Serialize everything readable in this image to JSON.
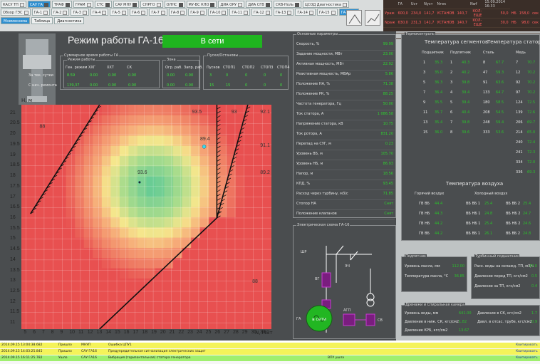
{
  "nav": {
    "row1": [
      "КАСУ ТП",
      "САУ ГА",
      "ТРАФ",
      "ГРАМ",
      "СТС",
      "САУ МНУ",
      "СНРГО",
      "ОЛНС",
      "МУ-ВС КЛО",
      "ДИА ОРУ",
      "ДИА СГВ",
      "СКВ-Ноль",
      "ЦСОД Диагностика"
    ],
    "row1_active": 1,
    "row2": [
      "Обзор ГЭС",
      "ГА-1",
      "ГА-2",
      "ГА-3",
      "ГА-4",
      "ГА-5",
      "ГА-6",
      "ГА-7",
      "ГА-8",
      "ГА-9",
      "ГА-10",
      "ГА-11",
      "ГА-12",
      "ГА-13",
      "ГА-14",
      "ГА-15",
      "ГА-16"
    ],
    "row2_active": 16,
    "tabs": [
      "Мнемосхема",
      "Таблица",
      "Диагностика"
    ]
  },
  "summary": {
    "headers": [
      "",
      "ГА",
      "Uст",
      "Nуст",
      "Nтек",
      "",
      "Nwf"
    ],
    "time": "15.09.2014 16:33",
    "rows": [
      {
        "label": "Ураж",
        "vals": [
          "600,0",
          "234,0",
          "141,7",
          "УСТАНОВ",
          "140,7",
          "КОЛ-ЕЩЕ",
          "50,0",
          "НБ",
          "158,0",
          "сек"
        ],
        "red": true
      },
      {
        "label": "Nраж",
        "vals": [
          "630,0",
          "231,3",
          "141,7",
          "УСТАНОВ",
          "140,7",
          "КОЛ-ЕЩЕ",
          "30,0",
          "НБ",
          "98,0",
          "сек"
        ],
        "red": true
      }
    ]
  },
  "header": {
    "title": "Режим работы ГА-16",
    "status": "В сети"
  },
  "time_block": {
    "legend": "Суммарное время работы ГА",
    "mode_legend": "Режим работы",
    "zone_legend": "Зона",
    "cols": [
      "Ген. режим",
      "ХХГ",
      "ХХТ",
      "СК",
      "Огр. раб.",
      "Запр. раб."
    ],
    "rows": [
      {
        "label": "За тек. сутки",
        "vals": [
          "8.59",
          "0.00",
          "0.00",
          "0.00",
          "0.00",
          "0.00"
        ]
      },
      {
        "label": "С нач. ремонта",
        "vals": [
          "139,37",
          "0.00",
          "0.00",
          "0.00",
          "0.00",
          "0.00"
        ]
      }
    ]
  },
  "starts_block": {
    "legend": "Пуски/Остановы",
    "cols": [
      "Пусков",
      "СТОП1",
      "СТОП2",
      "СТОП3",
      "СТОП4"
    ],
    "rows": [
      [
        "3",
        "0",
        "0",
        "0",
        "0"
      ],
      [
        "15",
        "15",
        "0",
        "0",
        "0"
      ]
    ]
  },
  "chart_data": {
    "type": "heatmap",
    "title": "",
    "ylabel": "H, м",
    "xlabel": "N, МВт",
    "x_ticks": [
      5,
      6,
      7,
      8,
      9,
      10,
      11,
      12,
      13,
      14,
      15,
      16,
      17,
      18,
      19,
      20,
      21,
      22,
      23,
      24,
      25,
      26,
      27,
      28,
      29,
      30,
      31
    ],
    "y_ticks": [
      11,
      11.5,
      12,
      12.5,
      13,
      13.5,
      14,
      14.5,
      15,
      15.5,
      16,
      16.5,
      17,
      17.5,
      18,
      18.5,
      19,
      19.5,
      20,
      20.5,
      21
    ],
    "xlim": [
      4.5,
      32
    ],
    "ylim": [
      10.7,
      21.4
    ],
    "contour_labels": [
      {
        "text": "88",
        "x": 6.8,
        "y": 20.3
      },
      {
        "text": "93.5",
        "x": 23.8,
        "y": 21.0
      },
      {
        "text": "93",
        "x": 27.9,
        "y": 21.0
      },
      {
        "text": "92.1",
        "x": 31.3,
        "y": 21.0
      },
      {
        "text": "91.1",
        "x": 31.3,
        "y": 19.4
      },
      {
        "text": "89.2",
        "x": 31.3,
        "y": 18.1
      },
      {
        "text": "93.6",
        "x": 17.8,
        "y": 18.1
      },
      {
        "text": "88",
        "x": 30.2,
        "y": 12.9
      },
      {
        "text": "89.4",
        "x": 24.7,
        "y": 19.7
      }
    ],
    "operating_points": [
      {
        "x": 24.6,
        "y": 19.4,
        "color": "#3ad6ee"
      },
      {
        "x": 17.5,
        "y": 17.7,
        "color": "#222222"
      }
    ],
    "left_boundary": [
      [
        5.5,
        16.2
      ],
      [
        13.1,
        21.4
      ]
    ],
    "right_boundary_upper": [
      [
        26.0,
        16.0
      ],
      [
        26.0,
        21.4
      ]
    ],
    "right_boundary_diag": [
      [
        13.1,
        10.7
      ],
      [
        26.0,
        16.0
      ]
    ],
    "right_boundary_line2": [
      [
        26.0,
        16.0
      ],
      [
        29.4,
        21.4
      ]
    ]
  },
  "params": {
    "legend": "Основные параметры",
    "rows": [
      {
        "name": "Скорость, %",
        "value": "99.99"
      },
      {
        "name": "Задание мощности, МВт",
        "value": "23.00"
      },
      {
        "name": "Активная мощность, МВт",
        "value": "22.92"
      },
      {
        "name": "Реактивная мощность, МВАр",
        "value": "5.86"
      },
      {
        "name": "Положение НА, %",
        "value": "71.38"
      },
      {
        "name": "Положение РК, %",
        "value": "88.25"
      },
      {
        "name": "Частота генератора, Гц",
        "value": "50.00"
      },
      {
        "name": "Ток статора, А",
        "value": "1 086.58"
      },
      {
        "name": "Напряжение статора, кВ",
        "value": "10.75"
      },
      {
        "name": "Ток ротора, А",
        "value": "831.20"
      },
      {
        "name": "Перепад на СУГ, м",
        "value": "0.23"
      },
      {
        "name": "Уровень ВБ, м",
        "value": "105.70"
      },
      {
        "name": "Уровень НБ, м",
        "value": "86.93"
      },
      {
        "name": "Напор, м",
        "value": "18.56"
      },
      {
        "name": "КПД, %",
        "value": "93.45"
      },
      {
        "name": "Расход через турбину, м3/с",
        "value": "71.85"
      },
      {
        "name": "Стопор НА",
        "value": "Снят"
      },
      {
        "name": "Положение клапанов",
        "value": "Снят"
      }
    ]
  },
  "thermo": {
    "legend": "Термоконтроль",
    "seg_title": "Температура сегментов",
    "stator_title": "Температура статора",
    "seg_cols": [
      "Подшипник",
      "Подпятник",
      "Сталь",
      "Медь"
    ],
    "seg_rows": [
      [
        "1",
        "35.3",
        "1",
        "40.3",
        "8",
        "67.7",
        "7",
        "70.7"
      ],
      [
        "3",
        "35.0",
        "2",
        "40.2",
        "47",
        "59.3",
        "12",
        "70.2"
      ],
      [
        "5",
        "36.3",
        "3",
        "39.8",
        "91",
        "63.6",
        "92",
        "70.2"
      ],
      [
        "7",
        "36.4",
        "4",
        "39.4",
        "133",
        "64.7",
        "97",
        "70.2"
      ],
      [
        "9",
        "35.5",
        "5",
        "39.4",
        "180",
        "58.5",
        "124",
        "72.5"
      ],
      [
        "11",
        "35.7",
        "6",
        "40.4",
        "208",
        "54.5",
        "139",
        "72.6"
      ],
      [
        "13",
        "35.4",
        "7",
        "39.8",
        "248",
        "59.4",
        "206",
        "69.7"
      ],
      [
        "15",
        "36.0",
        "8",
        "39.6",
        "333",
        "53.6",
        "214",
        "65.0"
      ],
      [
        "",
        "",
        "",
        "",
        "",
        "",
        "240",
        "72.4"
      ],
      [
        "",
        "",
        "",
        "",
        "",
        "",
        "241",
        "72.3"
      ],
      [
        "",
        "",
        "",
        "",
        "",
        "",
        "334",
        "72.0"
      ],
      [
        "",
        "",
        "",
        "",
        "",
        "",
        "336",
        "69.3"
      ]
    ],
    "air_title": "Температура воздуха",
    "air_hot": "Горячий воздух",
    "air_cold": "Холодный воздух",
    "air_rows": [
      [
        "ГВ ВБ",
        "44.4",
        "ВБ ВБ 1",
        "25.4",
        "ВБ ВБ 2",
        "25.4"
      ],
      [
        "ГВ НБ",
        "44.3",
        "ВБ НБ 1",
        "24.8",
        "ВБ НБ 2",
        "24.7"
      ],
      [
        "ГВ НБ",
        "44.2",
        "ВБ НБ 1",
        "25.4",
        "ВБ НБ 2",
        "24.6"
      ],
      [
        "ГВ ВБ",
        "44.2",
        "ВБ ВБ 1",
        "26.1",
        "ВБ ВБ 2",
        "24.8"
      ]
    ]
  },
  "scheme": {
    "legend": "Электрическая схема ГА-16",
    "labels": [
      "ШР",
      "ВГ",
      "ГА",
      "ЭЧ",
      "АГП",
      "СВ"
    ],
    "gen_text": "в сети"
  },
  "bearing": {
    "legend": "Подпятник",
    "rows": [
      {
        "name": "Уровень масла, мм",
        "value": "112.00"
      },
      {
        "name": "Температура масла, °С",
        "value": "36.85"
      }
    ]
  },
  "turbine": {
    "legend": "Турбинный подшипник",
    "rows": [
      {
        "name": "Расх. воды на охлажд. ТП, м3/ч",
        "value": "47.0"
      },
      {
        "name": "Давление перед ТП, кгс/см2",
        "value": "0.5"
      },
      {
        "name": "Давление за ТП, кгс/см2",
        "value": "0.4"
      }
    ]
  },
  "drain": {
    "legend": "Дренажи и Спиральная камера",
    "rows": [
      {
        "name": "Уровень воды, мм",
        "value": "641.00",
        "name2": "Давление в СК, кгс/см2",
        "value2": "1.7"
      },
      {
        "name": "Давление в ниж. СК, кгс/см2",
        "value": "1.82",
        "name2": "Давл. в отсас. трубе, кгс/см2",
        "value2": "0.9"
      },
      {
        "name": "Давление КРБ, кгс/см2",
        "value": "13.67",
        "name2": "",
        "value2": ""
      }
    ]
  },
  "alarms": [
    {
      "time": "2014.09.15 13:04:38.682",
      "state": "Пришло",
      "src": "МНУП",
      "text": "Ошибка ЦПУ1",
      "extra": "",
      "ack": "Квитировать",
      "color": "#f4f35a"
    },
    {
      "time": "2014.09.15 14:03:25.845",
      "state": "Пришло",
      "src": "САУ ГА16",
      "text": "Предупредительная сигнализация электрических защит",
      "extra": "",
      "ack": "Квитировать",
      "color": "#f4f35a"
    },
    {
      "time": "2014.09.15 16:11:25.782",
      "state": "Ушло",
      "src": "САУ ГА16",
      "text": "Вибрация (горизонтальная) статора генератора",
      "extra": "ВПУ ушла",
      "ack": "Квитировать",
      "color": "#9fef6f"
    }
  ],
  "colors": {
    "accent": "#2f8fd0",
    "ok": "#1fb51f",
    "value": "#2fd02f",
    "panel": "#4a4d4f"
  }
}
